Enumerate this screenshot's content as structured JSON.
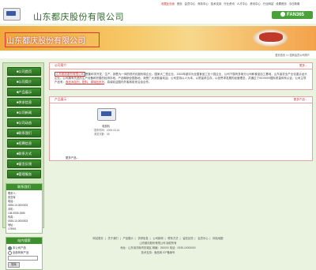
{
  "header": {
    "company_name": "山东都庆股份有限公司",
    "top_links": [
      "收藏此页面",
      "首页",
      "会员中心",
      "商务中心",
      "技术支持",
      "行业资讯",
      "人才中心",
      "资讯中心",
      "行业网站",
      "设置首页",
      "今日新闻"
    ],
    "brand_text": "FAN365"
  },
  "banner": {
    "text": "山东都庆股份有限公司"
  },
  "breadcrumb": "首页首页 >> 招商会员公司简介",
  "sidebar": {
    "nav": [
      "■公司首页",
      "■公司简介",
      "■产品展示",
      "■供求信息",
      "■公司新闻",
      "■公司动态",
      "■联系我们",
      "■招聘信息",
      "■联系方式",
      "■留言反馈",
      "■管理服务"
    ],
    "contact": {
      "title": "联系我们",
      "lines": [
        "联系人：",
        "张亚军",
        "电话：",
        "0535-10-0000003",
        "手机：",
        "138-0535-1580",
        "传真：",
        "0535-10-0000003",
        "地址：",
        "175901"
      ]
    },
    "search": {
      "title": "站内搜索",
      "option_company": "本公司产品",
      "option_all": "全部商家产品",
      "button": "搜索"
    }
  },
  "intro": {
    "title": "公司简介",
    "more": "更多...",
    "company_name": "山东都庆股份有限公司",
    "text": "是集科学开发、生产、销售为一体的现代化股份制企业，国家大二型企业，2003年被评为全国食品工业十强企业，公司下属有多家分公司和食品加工基地，山东省农业产业化重点龙头企业。公司拥有先进的生产设备和完善的检测手段，产品畅销全国各地，深受广大消费者欢迎。公司坚持以人为本、以质量求生存、以信誉求发展的经营理念，并通过了ISO9000国际质量体系认证。公司主导产品有：",
    "highlight": "食品添加剂、配料、调味品系列",
    "text2": "，真诚欢迎国内外客商前来洽谈合作。"
  },
  "products": {
    "title": "产品展示",
    "more": "更多产品...",
    "item_name": "电视机",
    "item_meta": [
      "发布时间：2008-03-16",
      "浏览次数：38"
    ],
    "more_link": "更多产品..."
  },
  "footer": {
    "links": [
      "网站首页",
      "关于我们",
      "产品展示",
      "供求信息",
      "公司新闻",
      "联系方式",
      "留言反馈",
      "会员中心",
      "网站地图"
    ],
    "lines": [
      "山东都庆股份有限公司 版权所有",
      "地址：山东省济南市历城区 邮编：250000 电话：0535-10000000",
      "技术支持：食品网 ICP备案号"
    ]
  }
}
